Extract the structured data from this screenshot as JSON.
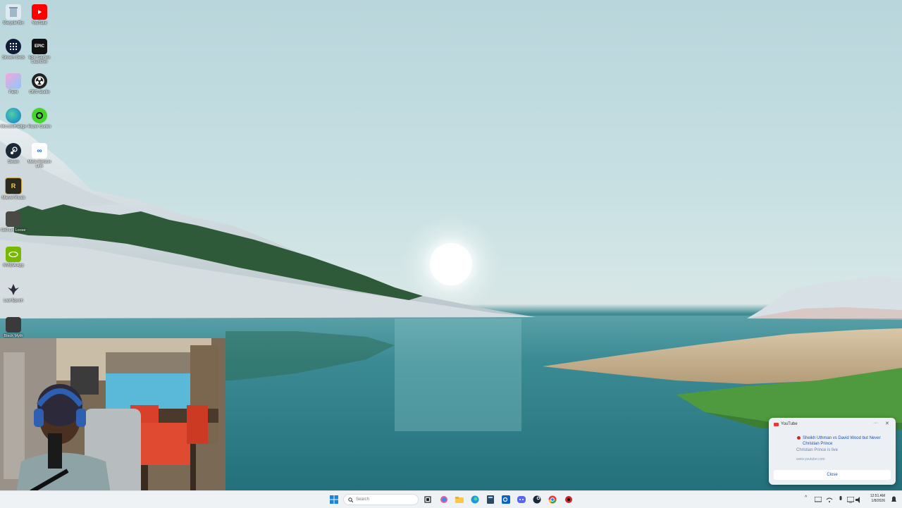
{
  "desktop": {
    "icons": [
      {
        "label": "Recycle Bin",
        "icon": "recycle-bin-icon"
      },
      {
        "label": "YouTube",
        "icon": "youtube-icon"
      },
      {
        "label": "Stream Deck",
        "icon": "stream-deck-icon"
      },
      {
        "label": "Epic Games Launcher",
        "icon": "epic-games-icon"
      },
      {
        "label": "Paint",
        "icon": "paint-icon"
      },
      {
        "label": "OBS Studio",
        "icon": "obs-icon"
      },
      {
        "label": "Microsoft Edge",
        "icon": "edge-icon"
      },
      {
        "label": "Razer Cortex",
        "icon": "razer-cortex-icon"
      },
      {
        "label": "Steam",
        "icon": "steam-icon"
      },
      {
        "label": "Meta Horizon Link",
        "icon": "meta-icon"
      },
      {
        "label": "Marvel Rivals",
        "icon": "marvel-rivals-icon"
      },
      {
        "label": "Hell Let Loose",
        "icon": "hell-let-loose-icon"
      },
      {
        "label": "NVIDIA App",
        "icon": "nvidia-icon"
      },
      {
        "label": "Last Epoch",
        "icon": "last-epoch-icon"
      },
      {
        "label": "Black Myth",
        "icon": "game-icon"
      }
    ]
  },
  "notification": {
    "app_name": "YouTube",
    "title": "Sheikh Uthman vs David Wood but Never Christian Prince",
    "subtitle": "Christian Prince is live",
    "site": "www.youtube.com",
    "close_label": "Close",
    "more_glyph": "···",
    "dismiss_glyph": "✕"
  },
  "taskbar": {
    "search_placeholder": "Search",
    "clock_time": "12:51 AM",
    "clock_date": "1/8/2026",
    "tray_chevron": "^"
  },
  "colors": {
    "accent": "#1f4fb0",
    "youtube_red": "#e53935",
    "taskbar_bg": "#eef2f4"
  }
}
